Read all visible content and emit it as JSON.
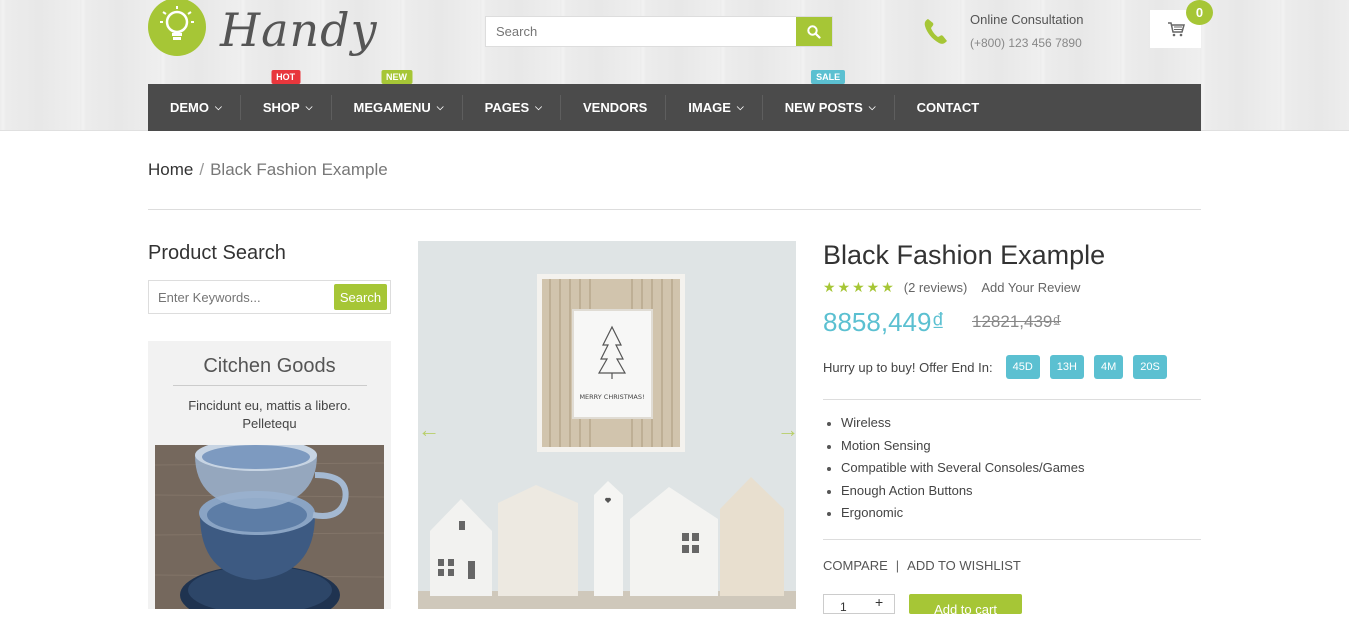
{
  "brand": {
    "name": "Handy"
  },
  "search": {
    "placeholder": "Search"
  },
  "consultation": {
    "title": "Online Consultation",
    "phone": "(+800) 123 456 7890"
  },
  "cart": {
    "count": "0"
  },
  "nav": {
    "items": [
      {
        "label": "DEMO",
        "has_dropdown": true
      },
      {
        "label": "SHOP",
        "has_dropdown": true,
        "tag": "HOT"
      },
      {
        "label": "MEGAMENU",
        "has_dropdown": true,
        "tag": "NEW"
      },
      {
        "label": "PAGES",
        "has_dropdown": true
      },
      {
        "label": "VENDORS",
        "has_dropdown": false
      },
      {
        "label": "IMAGE",
        "has_dropdown": true
      },
      {
        "label": "NEW POSTS",
        "has_dropdown": true,
        "tag": "SALE"
      },
      {
        "label": "CONTACT",
        "has_dropdown": false
      }
    ]
  },
  "breadcrumb": {
    "home": "Home",
    "sep": "/",
    "current": "Black Fashion Example"
  },
  "sidebar": {
    "search_title": "Product Search",
    "search_placeholder": "Enter Keywords...",
    "search_button": "Search",
    "promo": {
      "title": "Citchen Goods",
      "text": "Fincidunt eu, mattis a libero. Pelletequ"
    }
  },
  "product": {
    "title": "Black Fashion Example",
    "rating_stars": 5,
    "stars": "★★★★★",
    "reviews": "(2 reviews)",
    "add_review": "Add Your Review",
    "price_new": "8858,449₫",
    "price_old": "12821,439₫",
    "offer_label": "Hurry up to buy! Offer End In:",
    "timer": [
      "45D",
      "13H",
      "4M",
      "20S"
    ],
    "image_text": "MERRY CHRISTMAS!",
    "features": [
      "Wireless",
      "Motion Sensing",
      "Compatible with Several Consoles/Games",
      "Enough Action Buttons",
      "Ergonomic"
    ],
    "compare": "COMPARE",
    "pipe": "|",
    "wishlist": "ADD TO WISHLIST",
    "qty_value": "1",
    "qty_plus": "+",
    "add_to_cart": "Add to cart"
  },
  "colors": {
    "accent": "#a6c636",
    "price": "#5bc0d1",
    "nav_bg": "#4b4b4b",
    "hot": "#e8363c",
    "sale": "#5bc0d1"
  }
}
